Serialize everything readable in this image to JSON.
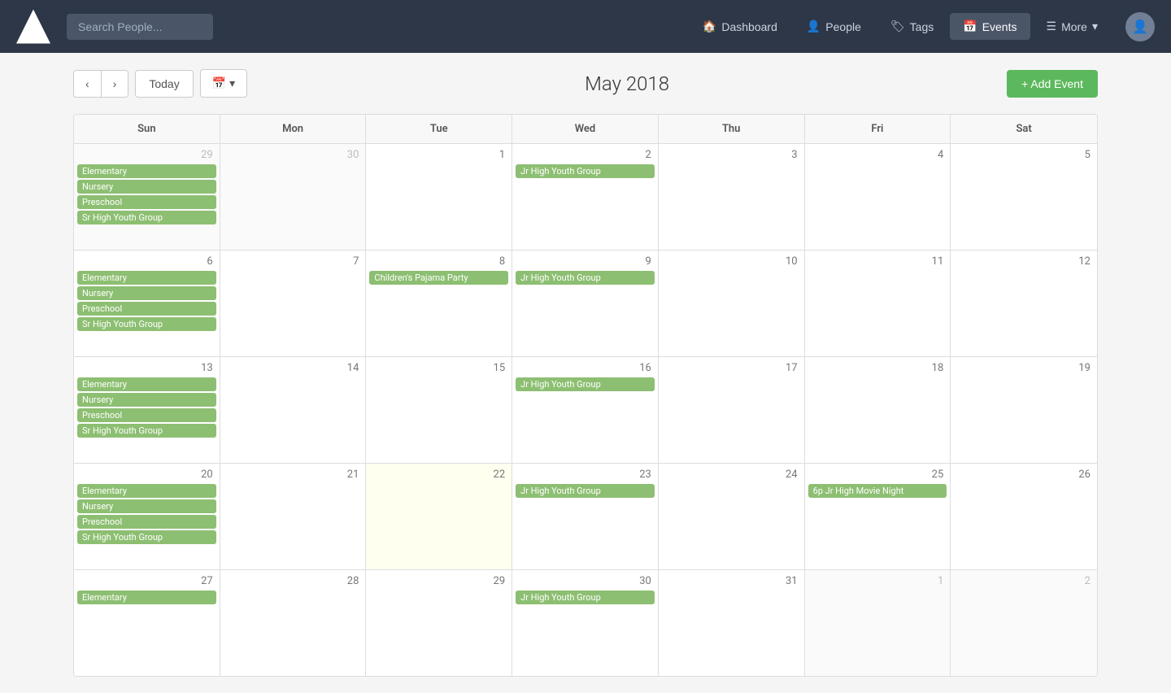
{
  "navbar": {
    "search_placeholder": "Search People...",
    "dashboard_label": "Dashboard",
    "people_label": "People",
    "tags_label": "Tags",
    "events_label": "Events",
    "more_label": "More",
    "icons": {
      "dashboard": "🏠",
      "people": "👤",
      "tags": "🏷",
      "events": "📅",
      "more": "☰"
    }
  },
  "calendar": {
    "title": "May 2018",
    "prev_label": "‹",
    "next_label": "›",
    "today_label": "Today",
    "view_icon": "📅",
    "add_event_label": "+ Add Event",
    "days_of_week": [
      "Sun",
      "Mon",
      "Tue",
      "Wed",
      "Thu",
      "Fri",
      "Sat"
    ],
    "weeks": [
      {
        "days": [
          {
            "date": 29,
            "other_month": true,
            "events": [
              "Elementary",
              "Nursery",
              "Preschool",
              "Sr High Youth Group"
            ]
          },
          {
            "date": 30,
            "other_month": true,
            "events": []
          },
          {
            "date": 1,
            "other_month": false,
            "events": []
          },
          {
            "date": 2,
            "other_month": false,
            "events": [
              "Jr High Youth Group"
            ]
          },
          {
            "date": 3,
            "other_month": false,
            "events": []
          },
          {
            "date": 4,
            "other_month": false,
            "events": []
          },
          {
            "date": 5,
            "other_month": false,
            "events": []
          }
        ]
      },
      {
        "days": [
          {
            "date": 6,
            "other_month": false,
            "events": [
              "Elementary",
              "Nursery",
              "Preschool",
              "Sr High Youth Group"
            ]
          },
          {
            "date": 7,
            "other_month": false,
            "events": []
          },
          {
            "date": 8,
            "other_month": false,
            "events": [
              "Children's Pajama Party"
            ]
          },
          {
            "date": 9,
            "other_month": false,
            "events": [
              "Jr High Youth Group"
            ]
          },
          {
            "date": 10,
            "other_month": false,
            "events": []
          },
          {
            "date": 11,
            "other_month": false,
            "events": []
          },
          {
            "date": 12,
            "other_month": false,
            "events": []
          }
        ]
      },
      {
        "days": [
          {
            "date": 13,
            "other_month": false,
            "events": [
              "Elementary",
              "Nursery",
              "Preschool",
              "Sr High Youth Group"
            ]
          },
          {
            "date": 14,
            "other_month": false,
            "events": []
          },
          {
            "date": 15,
            "other_month": false,
            "events": []
          },
          {
            "date": 16,
            "other_month": false,
            "events": [
              "Jr High Youth Group"
            ]
          },
          {
            "date": 17,
            "other_month": false,
            "events": []
          },
          {
            "date": 18,
            "other_month": false,
            "events": []
          },
          {
            "date": 19,
            "other_month": false,
            "events": []
          }
        ]
      },
      {
        "days": [
          {
            "date": 20,
            "other_month": false,
            "events": [
              "Elementary",
              "Nursery",
              "Preschool",
              "Sr High Youth Group"
            ]
          },
          {
            "date": 21,
            "other_month": false,
            "events": []
          },
          {
            "date": 22,
            "other_month": false,
            "events": [],
            "today": true
          },
          {
            "date": 23,
            "other_month": false,
            "events": [
              "Jr High Youth Group"
            ]
          },
          {
            "date": 24,
            "other_month": false,
            "events": []
          },
          {
            "date": 25,
            "other_month": false,
            "events": [
              "6p Jr High Movie Night"
            ]
          },
          {
            "date": 26,
            "other_month": false,
            "events": []
          }
        ]
      },
      {
        "days": [
          {
            "date": 27,
            "other_month": false,
            "events": [
              "Elementary"
            ]
          },
          {
            "date": 28,
            "other_month": false,
            "events": []
          },
          {
            "date": 29,
            "other_month": false,
            "events": []
          },
          {
            "date": 30,
            "other_month": false,
            "events": [
              "Jr High Youth Group"
            ]
          },
          {
            "date": 31,
            "other_month": false,
            "events": []
          },
          {
            "date": 1,
            "other_month": true,
            "events": []
          },
          {
            "date": 2,
            "other_month": true,
            "events": []
          }
        ]
      }
    ]
  }
}
